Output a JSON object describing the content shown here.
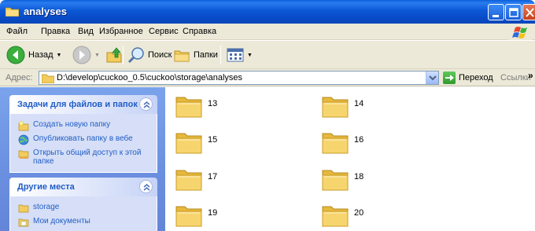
{
  "window": {
    "title": "analyses"
  },
  "menu": [
    {
      "label": "Файл"
    },
    {
      "label": "Правка"
    },
    {
      "label": "Вид"
    },
    {
      "label": "Избранное"
    },
    {
      "label": "Сервис"
    },
    {
      "label": "Справка"
    }
  ],
  "toolbar": {
    "back_label": "Назад",
    "search_label": "Поиск",
    "folders_label": "Папки"
  },
  "address": {
    "label": "Адрес:",
    "path": "D:\\develop\\cuckoo_0.5\\cuckoo\\storage\\analyses",
    "go_label": "Переход",
    "links_label": "Ссылки",
    "links_more": "»"
  },
  "tasks_panel": {
    "title": "Задачи для файлов и папок",
    "items": [
      {
        "label": "Создать новую папку"
      },
      {
        "label": "Опубликовать папку в вебе"
      },
      {
        "label": "Открыть общий доступ к этой папке"
      }
    ]
  },
  "places_panel": {
    "title": "Другие места",
    "items": [
      {
        "label": "storage"
      },
      {
        "label": "Мои документы"
      }
    ]
  },
  "folders": [
    {
      "name": "13"
    },
    {
      "name": "14"
    },
    {
      "name": "15"
    },
    {
      "name": "16"
    },
    {
      "name": "17"
    },
    {
      "name": "18"
    },
    {
      "name": "19"
    },
    {
      "name": "20"
    }
  ],
  "colors": {
    "titlebar": "#0a58d4",
    "taskpane": "#7ba3ec",
    "link": "#215dc6",
    "folder": "#f5d36e"
  }
}
